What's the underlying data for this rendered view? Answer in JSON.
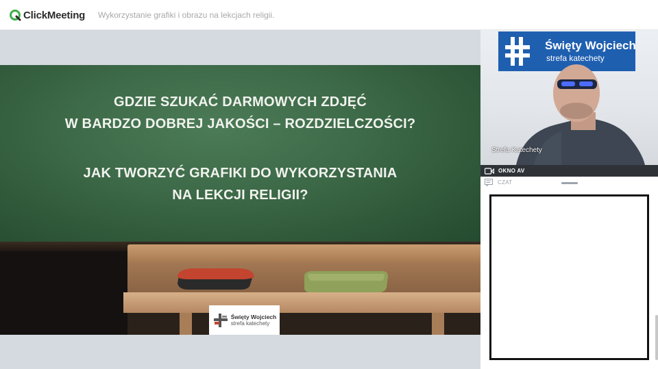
{
  "app": {
    "name": "ClickMeeting",
    "meeting_title": "Wykorzystanie grafiki i obrazu na lekcjach religii."
  },
  "slide": {
    "question1_line1": "GDZIE SZUKAĆ DARMOWYCH ZDJĘĆ",
    "question1_line2": "W BARDZO DOBREJ JAKOŚCI – ROZDZIELCZOŚCI?",
    "question2_line1": "JAK TWORZYĆ GRAFIKI DO WYKORZYSTANIA",
    "question2_line2": "NA LEKCJI RELIGII?",
    "logo_name": "Święty Wojciech",
    "logo_sub": "strefa katechety"
  },
  "video": {
    "banner_name": "Święty Wojciech",
    "banner_sub": "strefa katechety",
    "participant_name": "Strefa Katechety"
  },
  "panel": {
    "av_label": "OKNO AV",
    "chat_label": "CZAT"
  },
  "colors": {
    "brand_green": "#3fae49",
    "av_bar": "#2f3338",
    "banner_blue": "#1f5fb0",
    "chalkboard": "#3d6a48"
  }
}
